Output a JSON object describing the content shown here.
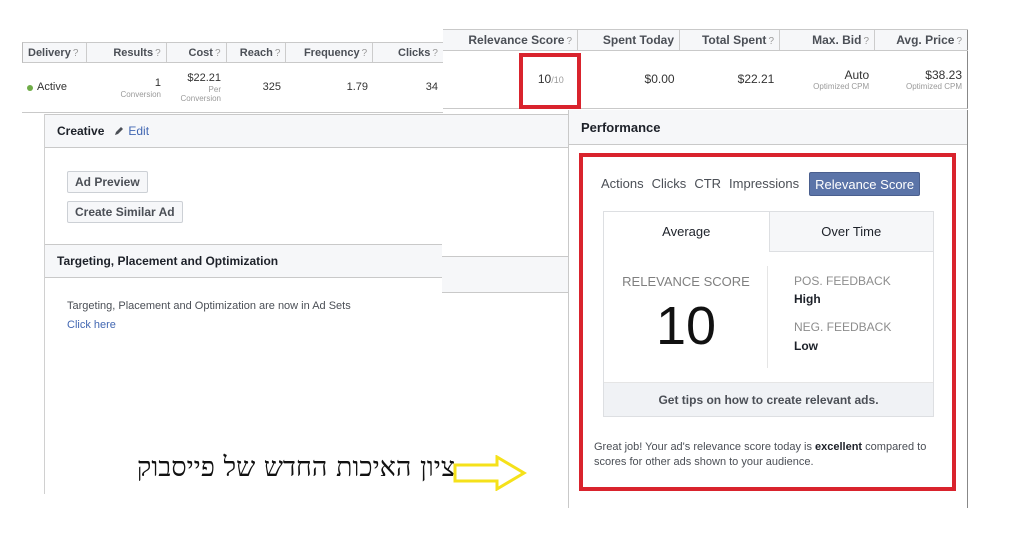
{
  "left_table": {
    "headers": [
      {
        "label": "Delivery",
        "help": "?"
      },
      {
        "label": "Results",
        "help": "?"
      },
      {
        "label": "Cost",
        "help": "?"
      },
      {
        "label": "Reach",
        "help": "?"
      },
      {
        "label": "Frequency",
        "help": "?"
      },
      {
        "label": "Clicks",
        "help": "?"
      }
    ],
    "row": {
      "delivery": "Active",
      "results": "1",
      "results_sub": "Conversion",
      "cost": "$22.21",
      "cost_sub_1": "Per",
      "cost_sub_2": "Conversion",
      "reach": "325",
      "frequency": "1.79",
      "clicks": "34"
    }
  },
  "right_table": {
    "headers": [
      {
        "label": "Relevance Score",
        "help": "?"
      },
      {
        "label": "Spent Today",
        "help": ""
      },
      {
        "label": "Total Spent",
        "help": "?"
      },
      {
        "label": "Max. Bid",
        "help": "?"
      },
      {
        "label": "Avg. Price",
        "help": "?"
      }
    ],
    "row": {
      "relevance_score": "10",
      "relevance_max": "/10",
      "spent_today": "$0.00",
      "total_spent": "$22.21",
      "max_bid": "Auto",
      "max_bid_sub": "Optimized CPM",
      "avg_price": "$38.23",
      "avg_price_sub": "Optimized CPM"
    }
  },
  "creative": {
    "title": "Creative",
    "edit_label": "Edit",
    "buttons": [
      "Ad Preview",
      "Create Similar Ad"
    ]
  },
  "targeting": {
    "title": "Targeting, Placement and Optimization",
    "text": "Targeting, Placement and Optimization are now in Ad Sets",
    "link": "Click here"
  },
  "performance": {
    "title": "Performance",
    "tabs": [
      "Actions",
      "Clicks",
      "CTR",
      "Impressions",
      "Relevance Score"
    ],
    "active_tab": "Relevance Score",
    "subtabs": [
      "Average",
      "Over Time"
    ],
    "score_label": "RELEVANCE SCORE",
    "score_value": "10",
    "pos_feedback_label": "POS. FEEDBACK",
    "pos_feedback_value": "High",
    "neg_feedback_label": "NEG. FEEDBACK",
    "neg_feedback_value": "Low",
    "tips_link": "Get tips on how to create relevant ads.",
    "summary_pre": "Great job! Your ad's relevance score today is ",
    "summary_bold": "excellent",
    "summary_post": " compared to scores for other ads shown to your audience."
  },
  "annotation": {
    "hebrew_caption": "ציון האיכות החדש של פייסבוק",
    "highlight_color": "#d9232d",
    "arrow_color": "#f5e11a"
  }
}
